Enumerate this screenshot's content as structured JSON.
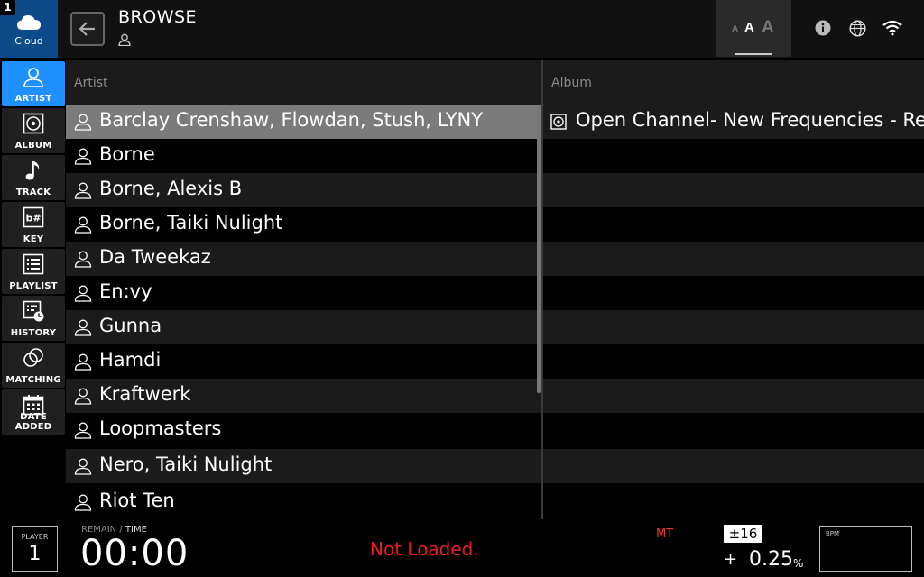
{
  "header": {
    "source": {
      "number": "1",
      "label": "Cloud"
    },
    "title": "BROWSE",
    "font_size_labels": [
      "A",
      "A",
      "A"
    ]
  },
  "sidebar": {
    "items": [
      {
        "label": "ARTIST",
        "icon": "person-icon",
        "active": true
      },
      {
        "label": "ALBUM",
        "icon": "disc-icon"
      },
      {
        "label": "TRACK",
        "icon": "music-note-icon"
      },
      {
        "label": "KEY",
        "icon": "key-icon"
      },
      {
        "label": "PLAYLIST",
        "icon": "playlist-icon"
      },
      {
        "label": "HISTORY",
        "icon": "history-icon"
      },
      {
        "label": "MATCHING",
        "icon": "matching-icon"
      },
      {
        "label": "DATE ADDED",
        "icon": "calendar-icon"
      }
    ]
  },
  "artist_column": {
    "header": "Artist",
    "rows": [
      "Barclay Crenshaw, Flowdan, Stush, LYNY",
      "Borne",
      "Borne, Alexis B",
      "Borne, Taiki Nulight",
      "Da Tweekaz",
      "En:vy",
      "Gunna",
      "Hamdi",
      "Kraftwerk",
      "Loopmasters",
      "Nero, Taiki Nulight",
      "Riot Ten"
    ]
  },
  "album_column": {
    "header": "Album",
    "rows": [
      "Open Channel- New Frequencies - Re"
    ]
  },
  "footer": {
    "player_label": "PLAYER",
    "player_number": "1",
    "remain_label": "REMAIN",
    "separator": " / ",
    "time_label": "TIME",
    "time_value": "00:00",
    "status": "Not Loaded.",
    "mt": "MT",
    "tempo_range": "±16",
    "tempo_sign": "+",
    "tempo_value": "0.25",
    "tempo_unit": "%",
    "bpm_label": "BPM"
  },
  "colors": {
    "active_tab": "#1e90ff",
    "source_button": "#0d4a8a",
    "selected_row": "#7b7b7b",
    "status_red": "#e81e1e"
  }
}
